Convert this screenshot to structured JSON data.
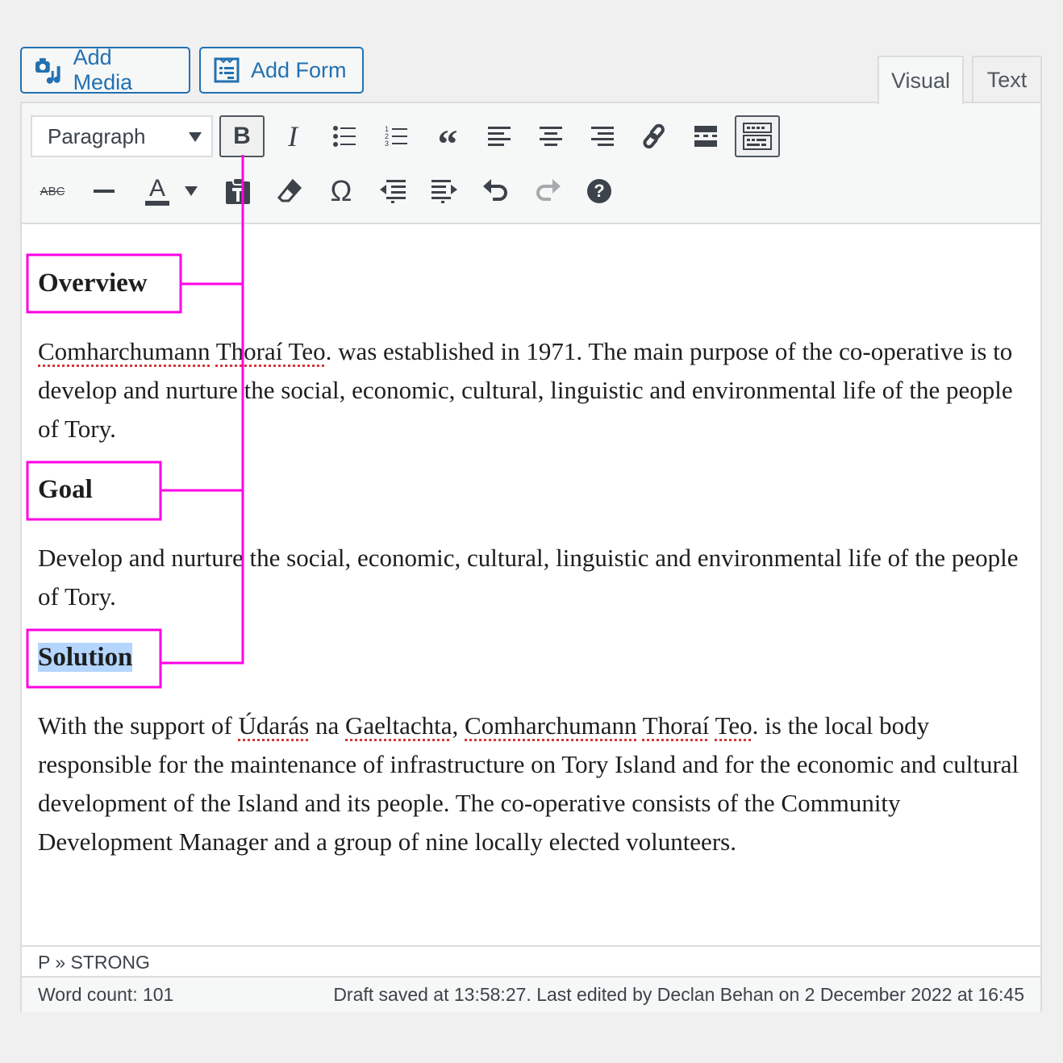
{
  "media_buttons": {
    "add_media": "Add Media",
    "add_form": "Add Form"
  },
  "tabs": {
    "visual": "Visual",
    "text": "Text",
    "active": "Visual"
  },
  "toolbar": {
    "format_select": "Paragraph",
    "row1": [
      "bold",
      "italic",
      "bulleted-list",
      "numbered-list",
      "blockquote",
      "align-left",
      "align-center",
      "align-right",
      "link",
      "read-more",
      "toolbar-toggle"
    ],
    "row2": [
      "strikethrough",
      "horizontal-line",
      "text-color",
      "paste-as-text",
      "clear-formatting",
      "special-character",
      "outdent",
      "indent",
      "undo",
      "redo",
      "help"
    ],
    "bold_label": "B",
    "italic_label": "I",
    "strike_label": "ABC",
    "omega": "Ω",
    "color_label": "A",
    "help": "?"
  },
  "content": {
    "h1": "Overview",
    "p1": [
      {
        "text": "Comharchumann",
        "misspelled": true
      },
      {
        "text": " "
      },
      {
        "text": "Thoraí Teo",
        "misspelled": true
      },
      {
        "text": ". was established in 1971. The main purpose of the co-operative is to develop and nurture the social, economic, cultural, linguistic and environmental life of the people of Tory."
      }
    ],
    "h2": "Goal",
    "p2": "Develop and nurture the social, economic, cultural, linguistic and environmental life of the people of Tory.",
    "h3": "Solution",
    "p3": [
      {
        "text": "With the support of "
      },
      {
        "text": "Údarás",
        "misspelled": true
      },
      {
        "text": " na "
      },
      {
        "text": "Gaeltachta",
        "misspelled": true
      },
      {
        "text": ", "
      },
      {
        "text": "Comharchumann",
        "misspelled": true
      },
      {
        "text": " "
      },
      {
        "text": "Thoraí",
        "misspelled": true
      },
      {
        "text": " "
      },
      {
        "text": "Teo",
        "misspelled": true
      },
      {
        "text": ". is the local body responsible for the maintenance of infrastructure on Tory Island and for the economic and cultural development of the Island and its people. The co-operative consists of the Community Development Manager and a group of nine locally elected volunteers."
      }
    ]
  },
  "path": "P » STRONG",
  "status": {
    "word_count": "Word count: 101",
    "saved": "Draft saved at 13:58:27. Last edited by Declan Behan on 2 December 2022 at 16:45"
  },
  "colors": {
    "accent": "#2271b1",
    "annotation": "#ff00e6",
    "selection": "#b4d5fe",
    "spell": "#d63638"
  }
}
